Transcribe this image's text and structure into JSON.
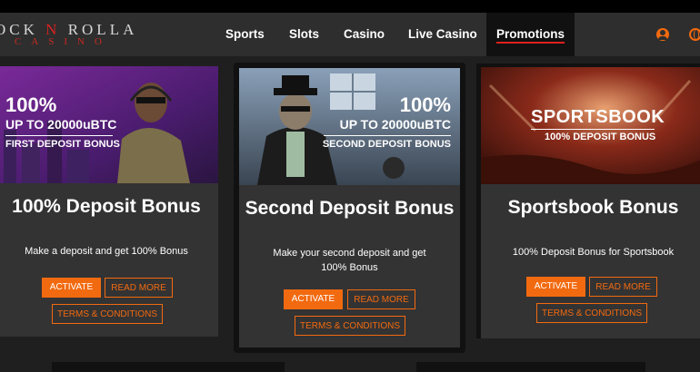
{
  "brand": {
    "logo_top": "OCK",
    "logo_n": "N",
    "logo_rest": "ROLLA",
    "logo_bottom": "CASINO"
  },
  "nav": {
    "items": [
      "Sports",
      "Slots",
      "Casino",
      "Live Casino",
      "Promotions"
    ],
    "active": "Promotions"
  },
  "icons": {
    "account": "user-icon",
    "language": "globe-icon"
  },
  "colors": {
    "accent": "#f26a10",
    "active_underline": "#e0201f",
    "card_bg": "#333333",
    "page_bg": "#1f1f1f"
  },
  "promotions": [
    {
      "image_pct": "100%",
      "image_amount": "UP TO 20000uBTC",
      "image_caption": "FIRST DEPOSIT BONUS",
      "title": "100% Deposit Bonus",
      "description": "Make a deposit and get 100% Bonus",
      "activate_label": "ACTIVATE",
      "read_more_label": "READ MORE",
      "terms_label": "TERMS & CONDITIONS"
    },
    {
      "image_pct": "100%",
      "image_amount": "UP TO 20000uBTC",
      "image_caption": "SECOND DEPOSIT BONUS",
      "title": "Second Deposit Bonus",
      "description": "Make your second deposit and get 100% Bonus",
      "activate_label": "ACTIVATE",
      "read_more_label": "READ MORE",
      "terms_label": "TERMS & CONDITIONS"
    },
    {
      "image_title": "SPORTSBOOK",
      "image_caption": "100% DEPOSIT BONUS",
      "title": "Sportsbook Bonus",
      "description": "100% Deposit Bonus for Sportsbook",
      "activate_label": "ACTIVATE",
      "read_more_label": "READ MORE",
      "terms_label": "TERMS & CONDITIONS"
    }
  ]
}
